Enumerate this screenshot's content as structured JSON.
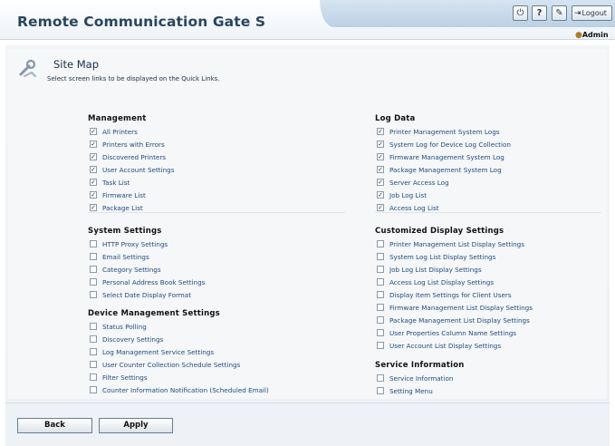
{
  "app": {
    "title": "Remote Communication Gate S"
  },
  "header": {
    "power_glyph": "⏻",
    "help_glyph": "?",
    "tool_glyph": "✎",
    "logout_glyph": "⇥",
    "logout_label": "Logout",
    "user_glyph": "●",
    "user_label": "Admin"
  },
  "page": {
    "title": "Site Map",
    "description": "Select screen links to be displayed on the Quick Links."
  },
  "check_glyph": "✓",
  "sections": {
    "management": {
      "title": "Management",
      "items": [
        {
          "label": "All Printers",
          "checked": true
        },
        {
          "label": "Printers with Errors",
          "checked": true
        },
        {
          "label": "Discovered Printers",
          "checked": true
        },
        {
          "label": "User Account Settings",
          "checked": true
        },
        {
          "label": "Task List",
          "checked": true
        },
        {
          "label": "Firmware List",
          "checked": true
        },
        {
          "label": "Package List",
          "checked": true
        }
      ]
    },
    "system_settings": {
      "title": "System Settings",
      "items": [
        {
          "label": "HTTP Proxy Settings",
          "checked": false
        },
        {
          "label": "Email Settings",
          "checked": false
        },
        {
          "label": "Category Settings",
          "checked": false
        },
        {
          "label": "Personal Address Book Settings",
          "checked": false
        },
        {
          "label": "Select Date Display Format",
          "checked": false
        }
      ]
    },
    "device_management": {
      "title": "Device Management Settings",
      "items": [
        {
          "label": "Status Polling",
          "checked": false
        },
        {
          "label": "Discovery Settings",
          "checked": false
        },
        {
          "label": "Log Management Service Settings",
          "checked": false
        },
        {
          "label": "User Counter Collection Schedule Settings",
          "checked": false
        },
        {
          "label": "Filter Settings",
          "checked": false
        },
        {
          "label": "Counter Information Notification (Scheduled Email)",
          "checked": false
        }
      ]
    },
    "log_data": {
      "title": "Log Data",
      "items": [
        {
          "label": "Printer Management System Logs",
          "checked": true
        },
        {
          "label": "System Log for Device Log Collection",
          "checked": true
        },
        {
          "label": "Firmware Management System Log",
          "checked": true
        },
        {
          "label": "Package Management System Log",
          "checked": true
        },
        {
          "label": "Server Access Log",
          "checked": true
        },
        {
          "label": "Job Log List",
          "checked": true
        },
        {
          "label": "Access Log List",
          "checked": true
        }
      ]
    },
    "customized_display": {
      "title": "Customized Display Settings",
      "items": [
        {
          "label": "Printer Management List Display Settings",
          "checked": false
        },
        {
          "label": "System Log List Display Settings",
          "checked": false
        },
        {
          "label": "Job Log List Display Settings",
          "checked": false
        },
        {
          "label": "Access Log List Display Settings",
          "checked": false
        },
        {
          "label": "Display Item Settings for Client Users",
          "checked": false
        },
        {
          "label": "Firmware Management List Display Settings",
          "checked": false
        },
        {
          "label": "Package Management List Display Settings",
          "checked": false
        },
        {
          "label": "User Properties Column Name Settings",
          "checked": false
        },
        {
          "label": "User Account List Display Settings",
          "checked": false
        }
      ]
    },
    "service_information": {
      "title": "Service Information",
      "items": [
        {
          "label": "Service Information",
          "checked": false
        },
        {
          "label": "Setting Menu",
          "checked": false
        }
      ]
    }
  },
  "footer": {
    "back_label": "Back",
    "apply_label": "Apply"
  }
}
